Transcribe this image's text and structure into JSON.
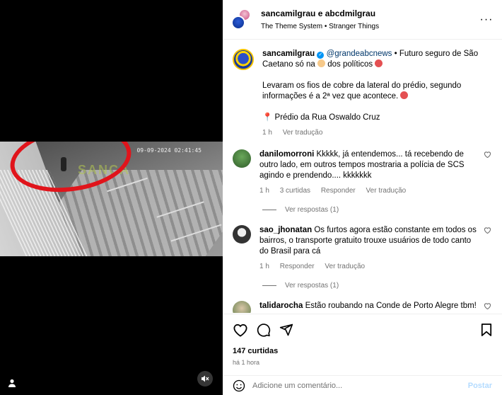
{
  "media": {
    "timestamp": "09-09-2024 02:41:45",
    "watermark": "SANCA",
    "muted": true,
    "annotation_color": "#e0141b"
  },
  "header": {
    "title": "sancamilgrau e abcdmilgrau",
    "subtitle": "The Theme System • Stranger Things",
    "more_icon": "more-horizontal-icon"
  },
  "caption": {
    "user": "sancamilgrau",
    "mention": "@grandeabcnews",
    "text_a": "• Futuro seguro de São Caetano só na",
    "text_b": "dos políticos",
    "paragraph2": "Levaram os fios de cobre da lateral do prédio, segundo informações é a 2ª vez que acontece.",
    "location": "Prédio da Rua Oswaldo Cruz",
    "time": "1 h",
    "translate": "Ver tradução"
  },
  "comments": [
    {
      "user": "danilomorroni",
      "text": "Kkkkk, já entendemos... tá recebendo de outro lado, em outros tempos mostraria a polícia de SCS agindo e prendendo.... kkkkkkk",
      "time": "1 h",
      "likes": "3 curtidas",
      "reply": "Responder",
      "translate": "Ver tradução",
      "replies": "Ver respostas (1)"
    },
    {
      "user": "sao_jhonatan",
      "text": "Os furtos agora estão constante em todos os bairros, o transporte gratuito trouxe usuários de todo canto do Brasil para cá",
      "time": "1 h",
      "reply": "Responder",
      "translate": "Ver tradução",
      "replies": "Ver respostas (1)"
    },
    {
      "user": "talidarocha",
      "text": "Estão roubando na Conde de Porto Alegre tbm!"
    }
  ],
  "footer": {
    "likes": "147 curtidas",
    "time": "há 1 hora",
    "comment_placeholder": "Adicione um comentário...",
    "post": "Postar"
  }
}
